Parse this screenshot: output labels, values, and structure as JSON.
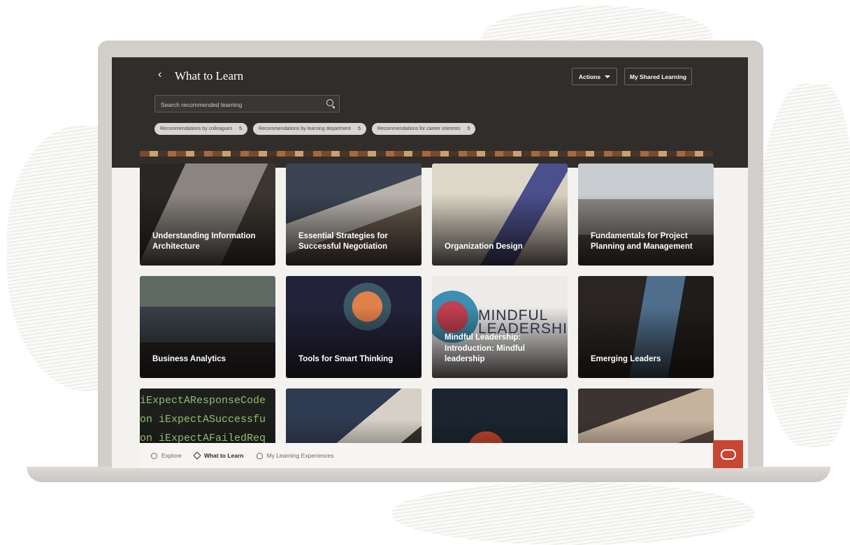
{
  "header": {
    "back_icon": "chevron-left-icon",
    "title": "What to Learn",
    "actions_label": "Actions",
    "shared_learning_label": "My Shared Learning"
  },
  "search": {
    "placeholder": "Search recommended learning",
    "icon": "search-icon"
  },
  "chips": [
    {
      "label": "Recommendations by colleagues",
      "count": "5"
    },
    {
      "label": "Recommendations by learning department",
      "count": "5"
    },
    {
      "label": "Recommendations for career interests",
      "count": "5"
    }
  ],
  "tiles": [
    {
      "title": "Understanding Information Architecture"
    },
    {
      "title": "Essential Strategies for Successful Negotiation"
    },
    {
      "title": "Organization Design"
    },
    {
      "title": "Fundamentals for Project Planning and Management"
    },
    {
      "title": "Business Analytics"
    },
    {
      "title": "Tools for Smart Thinking"
    },
    {
      "title": "Mindful Leadership: Introduction: Mindful leadership",
      "image_text": "MINDFUL\nLEADERSHI"
    },
    {
      "title": "Emerging Leaders"
    },
    {
      "title": "",
      "image_text": "iExpectAResponseCode\non iExpectASuccessfu\non iExpectAFailedReq"
    },
    {
      "title": ""
    },
    {
      "title": ""
    },
    {
      "title": ""
    }
  ],
  "bottom_nav": {
    "items": [
      {
        "label": "Explore",
        "icon": "eye-icon"
      },
      {
        "label": "What to Learn",
        "icon": "cube-icon",
        "active": true
      },
      {
        "label": "My Learning Experiences",
        "icon": "lightbulb-icon"
      }
    ]
  },
  "brand_color": "#c74634",
  "header_color": "#312d2a"
}
